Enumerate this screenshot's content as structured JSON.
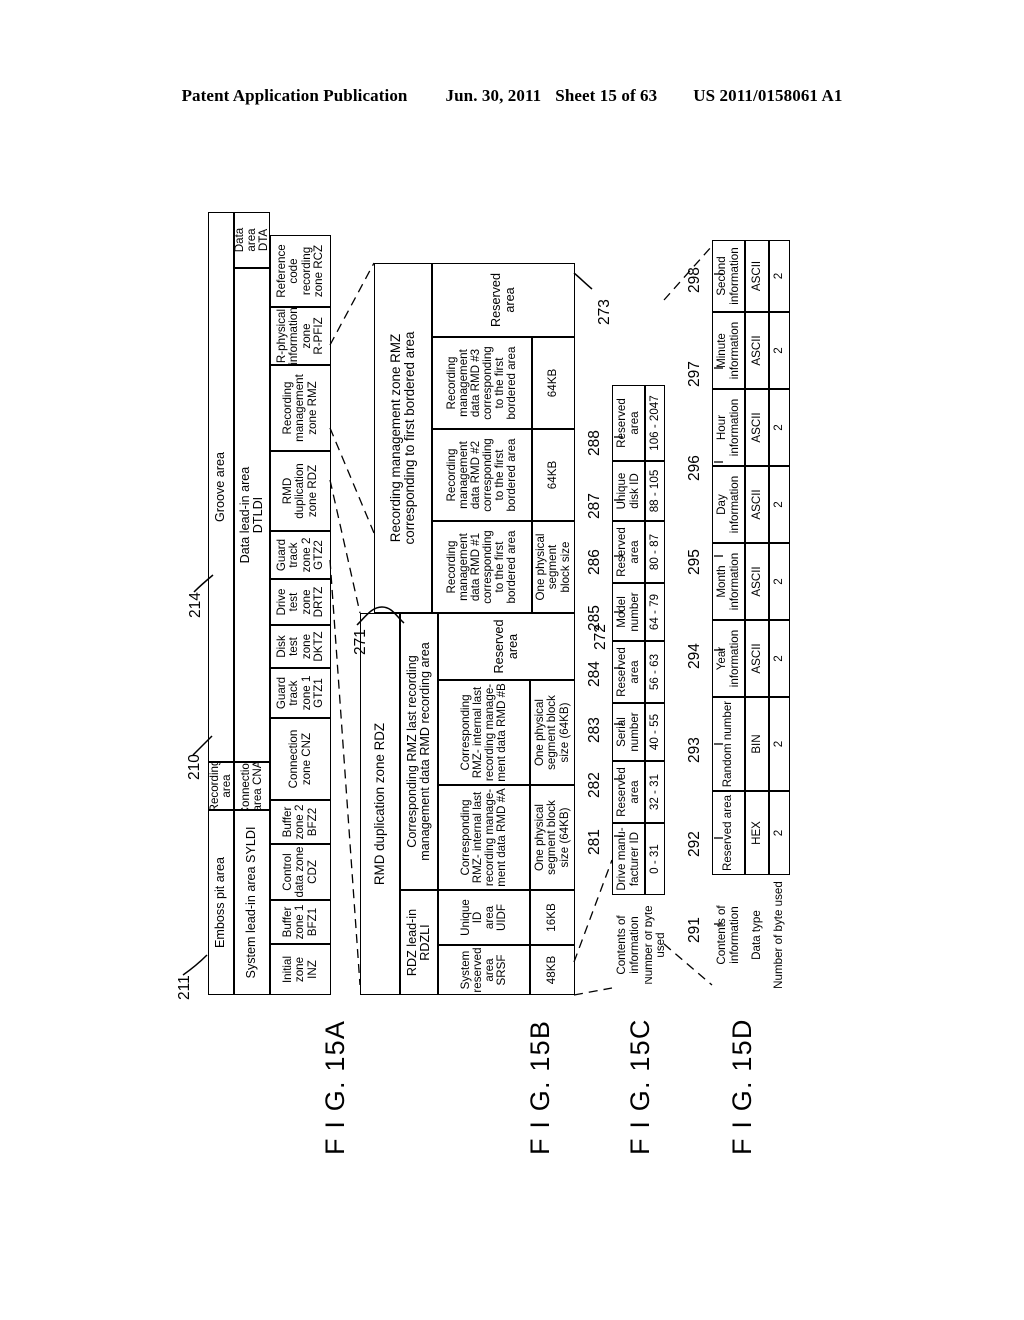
{
  "header": {
    "publication": "Patent Application Publication",
    "date": "Jun. 30, 2011",
    "sheet": "Sheet 15 of 63",
    "docnum": "US 2011/0158061 A1"
  },
  "captions": {
    "fig_a": "F I G. 15A",
    "fig_b": "F I G. 15B",
    "fig_c": "F I G. 15C",
    "fig_d": "F I G. 15D"
  },
  "numerals": {
    "n210": "210",
    "n211": "211",
    "n214": "214",
    "n271": "271",
    "n272": "272",
    "n273": "273",
    "n281": "281",
    "n282": "282",
    "n283": "283",
    "n284": "284",
    "n285": "285",
    "n286": "286",
    "n287": "287",
    "n288": "288",
    "n291": "291",
    "n292": "292",
    "n293": "293",
    "n294": "294",
    "n295": "295",
    "n296": "296",
    "n297": "297",
    "n298": "298"
  },
  "fig15a": {
    "row1": {
      "emboss": "Emboss pit area",
      "recording": "Recording\narea",
      "groove": "Groove area"
    },
    "row2": {
      "syldi": "System lead-in area SYLDI",
      "cna": "Connection\narea CNA",
      "dtldi": "Data lead-in area\nDTLDI",
      "dta": "Data\narea\nDTA"
    },
    "row3": [
      "Initial\nzone INZ",
      "Buffer\nzone 1\nBFZ1",
      "Control\ndata zone\nCDZ",
      "Buffer\nzone 2\nBFZ2",
      "Connection\nzone CNZ",
      "Guard\ntrack\nzone 1\nGTZ1",
      "Disk\ntest\nzone\nDKTZ",
      "Drive\ntest\nzone\nDRTZ",
      "Guard\ntrack\nzone 2\nGTZ2",
      "RMD\nduplication\nzone RDZ",
      "Recording\nmanagement\nzone RMZ",
      "R-physical\ninformation\nzone\nR-PFIZ",
      "Reference\ncode\nrecording\nzone RCZ"
    ]
  },
  "fig15b": {
    "title": "RMD duplication zone RDZ",
    "group_lead": "RDZ lead-in\nRDZLI",
    "group_last": "Corresponding RMZ last recording\nmanagement data RMD recording area",
    "cells": [
      "System\nreserved\narea\nSRSF",
      "Unique\nID\narea\nUIDF",
      "Corresponding\nRMZ- internal last\nrecording manage-\nment data RMD #A",
      "Corresponding\nRMZ- internal last\nrecording manage-\nment data RMD #B",
      "Reserved\narea"
    ],
    "sizes": [
      "48KB",
      "16KB",
      "One physical\nsegment block\nsize (64KB)",
      "One physical\nsegment block\nsize (64KB)"
    ]
  },
  "fig15b2": {
    "title": "Recording management zone RMZ\ncorresponding to first bordered area",
    "cells": [
      "Recording\nmanagement\ndata RMD #1\ncorresponding\nto the first\nbordered area",
      "Recording\nmanagement\ndata RMD #2\ncorresponding\nto the first\nbordered area",
      "Recording\nmanagement\ndata RMD #3\ncorresponding\nto the first\nbordered area",
      "Reserved\narea"
    ],
    "sizes": [
      "One physical\nsegment\nblock size",
      "64KB",
      "64KB"
    ]
  },
  "fig15c": {
    "rowlabels": [
      "Contents of\ninformation",
      "Number of byte used"
    ],
    "columns": [
      {
        "content": "Drive manu-\nfacturer ID",
        "bytes": "0 - 31"
      },
      {
        "content": "Reserved\narea",
        "bytes": "32 - 31"
      },
      {
        "content": "Serial\nnumber",
        "bytes": "40 - 55"
      },
      {
        "content": "Reserved\narea",
        "bytes": "56 - 63"
      },
      {
        "content": "Model\nnumber",
        "bytes": "64 - 79"
      },
      {
        "content": "Reserved\narea",
        "bytes": "80 - 87"
      },
      {
        "content": "Unique\ndisk ID",
        "bytes": "88 - 105"
      },
      {
        "content": "Reserved\narea",
        "bytes": "106 - 2047"
      }
    ]
  },
  "fig15d": {
    "rowlabels": [
      "Contents of\ninformation",
      "Data type",
      "Number of byte used"
    ],
    "columns": [
      {
        "content": "Reserved area",
        "type": "HEX",
        "bytes": "2"
      },
      {
        "content": "Random number",
        "type": "BIN",
        "bytes": "2"
      },
      {
        "content": "Year\ninformation",
        "type": "ASCII",
        "bytes": "2"
      },
      {
        "content": "Month\ninformation",
        "type": "ASCII",
        "bytes": "2"
      },
      {
        "content": "Day\ninformation",
        "type": "ASCII",
        "bytes": "2"
      },
      {
        "content": "Hour\ninformation",
        "type": "ASCII",
        "bytes": "2"
      },
      {
        "content": "Minute\ninformation",
        "type": "ASCII",
        "bytes": "2"
      },
      {
        "content": "Second\ninformation",
        "type": "ASCII",
        "bytes": "2"
      }
    ]
  }
}
